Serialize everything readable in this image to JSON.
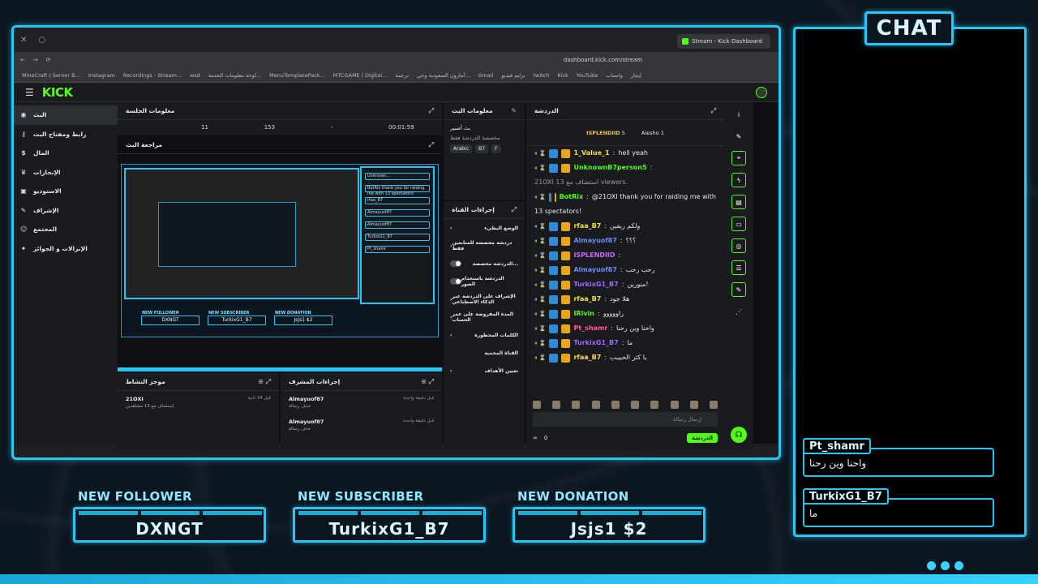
{
  "browser": {
    "tab_title": "Stream - Kick Dashboard",
    "url": "dashboard.kick.com/stream",
    "bookmarks": [
      "MineCraft | Server B...",
      "Instagram",
      "Recordings - Stream...",
      "wsd",
      "لوحة معلومات الخدمة...",
      "MenuTemplatePack...",
      "MTCGAME | Digital...",
      "ترجمة",
      "أمازون السعودية وجي...",
      "Gmail",
      "برايم فيديو",
      "twitch",
      "Kick",
      "YouTube",
      "واتساب",
      "إيجار"
    ]
  },
  "kick": {
    "logo": "KICK",
    "sidebar": [
      {
        "label": "البث",
        "icon": "broadcast-icon"
      },
      {
        "label": "رابط ومفتاح البث",
        "icon": "key-icon"
      },
      {
        "label": "المال",
        "icon": "money-icon"
      },
      {
        "label": "الإنجازات",
        "icon": "trophy-icon"
      },
      {
        "label": "الاستوديو",
        "icon": "studio-icon"
      },
      {
        "label": "الإشراف",
        "icon": "wrench-icon"
      },
      {
        "label": "المجتمع",
        "icon": "community-icon"
      },
      {
        "label": "الإنزالات و الجوائز",
        "icon": "gift-icon"
      }
    ],
    "session_title": "معلومات الجلسة",
    "session_stats": [
      "",
      "11",
      "153",
      "-",
      "00:01:59"
    ],
    "preview_title": "مراجعة البث",
    "activity_title": "موجز النشاط",
    "activity": [
      {
        "name": "21OXI",
        "detail": "إستضاف مع 13 مشاهدين",
        "time": "قبل 34 ثانية"
      }
    ],
    "mod_title": "إجراءات المشرف",
    "mod_actions": [
      {
        "name": "Almayuof87",
        "detail": "حذف رسالة",
        "time": "قبل دقيقة واحدة"
      },
      {
        "name": "Almayuof87",
        "detail": "حذف رسالة",
        "time": "قبل دقيقة واحدة"
      }
    ],
    "stream_info_title": "معلومات البث",
    "stream_info_label": "بث أصبير",
    "stream_info_sub": "مخصصة للدردشة فقط",
    "tags": [
      "Arabic",
      "B7",
      "F"
    ],
    "channel_actions_title": "إجراءات القناة",
    "channel_actions": [
      "الوضع البطيء",
      "دردشة مخصصة للمتابعين فقط",
      "الدردشة مخصصة...",
      "الدردشة باستخدام الصور",
      "الإشراف على الدردشة عبر الذكاء الاصطناعي",
      "المدة المفروضة على عمر الحساب",
      "الكلمات المحظورة",
      "القناة المحمية",
      "تعيين الأهداف"
    ],
    "chat_title": "الدردشة",
    "pinned": {
      "left": "ISPLENDIID",
      "left_count": "5",
      "right": "Aiesho",
      "right_count": "1"
    },
    "chat_placeholder": "إرسال رسالة",
    "chat_button": "الدردشة",
    "chat_count": "0"
  },
  "chat_messages": [
    {
      "user": "1_Value_1",
      "color": "#f4e04d",
      "text": "hell yeah"
    },
    {
      "user": "UnknownB7person5",
      "color": "#53fc18",
      "text": ""
    },
    {
      "user": "",
      "color": "#999",
      "text": "21OXI 13 استضاف مع viewers."
    },
    {
      "user": "BotRix",
      "color": "#53fc18",
      "text": "@21OXI thank you for raiding me with"
    },
    {
      "user": "",
      "color": "#e8e8e8",
      "text": "13 spectators!"
    },
    {
      "user": "rfaa_B7",
      "color": "#f4e04d",
      "text": "ولكم ريفين"
    },
    {
      "user": "Almayuof87",
      "color": "#6a8cff",
      "text": "؟؟؟"
    },
    {
      "user": "ISPLENDIID",
      "color": "#c86bff",
      "text": ""
    },
    {
      "user": "Almayuof87",
      "color": "#6a8cff",
      "text": "رحب رحب"
    },
    {
      "user": "TurkixG1_B7",
      "color": "#a06bff",
      "text": "منورين!"
    },
    {
      "user": "rfaa_B7",
      "color": "#f4e04d",
      "text": "هلا جود"
    },
    {
      "user": "IRlvin",
      "color": "#53fc18",
      "text": "راووووو"
    },
    {
      "user": "Pt_shamr",
      "color": "#ff5a9a",
      "text": "واحنا وين رحنا"
    },
    {
      "user": "TurkixG1_B7",
      "color": "#a06bff",
      "text": "ما"
    },
    {
      "user": "rfaa_B7",
      "color": "#f4e04d",
      "text": "يا كثر الحبيبب"
    }
  ],
  "preview": {
    "chat_lines": [
      "Unknown...",
      "BotRix thank you for raiding me with 13 spectators!",
      "rfaa_B7",
      "Almayuof87",
      "Almayuof87",
      "TurkixG1_B7",
      "Pt_shamr"
    ],
    "boxes": [
      {
        "cap": "NEW FOLLOWER",
        "val": "DXNGT"
      },
      {
        "cap": "NEW SUBSCRIBER",
        "val": "TurkixG1_B7"
      },
      {
        "cap": "NEW DONATION",
        "val": "Jsjs1 $2"
      }
    ]
  },
  "overlay": {
    "chat_label": "CHAT",
    "bubbles": [
      {
        "name": "Pt_shamr",
        "text": "واحنا وين رحنا"
      },
      {
        "name": "TurkixG1_B7",
        "text": "ما"
      }
    ],
    "alerts": [
      {
        "cap": "NEW FOLLOWER",
        "val": "DXNGT"
      },
      {
        "cap": "NEW SUBSCRIBER",
        "val": "TurkixG1_B7"
      },
      {
        "cap": "NEW DONATION",
        "val": "Jsjs1  $2"
      }
    ]
  },
  "colors": {
    "accent": "#26c6f5",
    "kick_green": "#53fc18",
    "background": "#0c1620"
  }
}
